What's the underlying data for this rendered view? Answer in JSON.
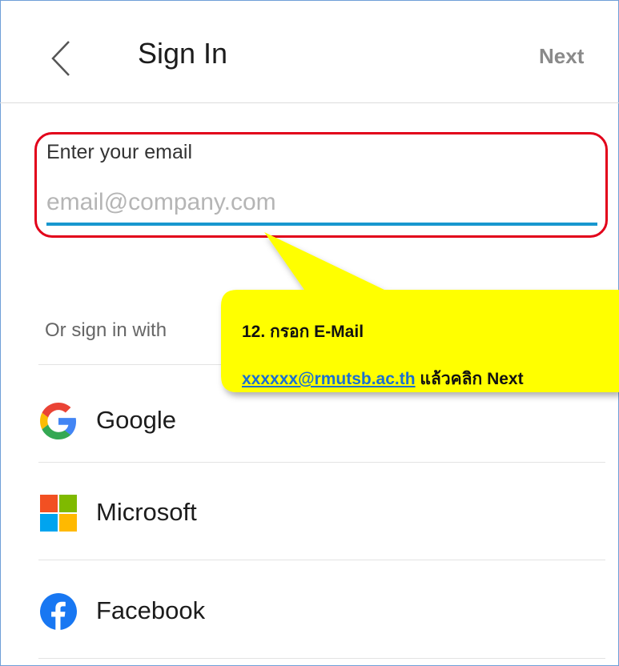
{
  "header": {
    "title": "Sign In",
    "next_label": "Next"
  },
  "email": {
    "label": "Enter your email",
    "placeholder": "email@company.com",
    "value": ""
  },
  "social": {
    "or_label": "Or sign in with",
    "providers": [
      {
        "label": "Google",
        "icon": "google-icon"
      },
      {
        "label": "Microsoft",
        "icon": "microsoft-icon"
      },
      {
        "label": "Facebook",
        "icon": "facebook-icon"
      }
    ]
  },
  "callout": {
    "line1": "12. กรอก E-Mail",
    "link": "xxxxxx@rmutsb.ac.th",
    "line2_suffix": " แล้วคลิก Next",
    "fill_color": "#ffff00",
    "highlight_color": "#e2001a"
  }
}
